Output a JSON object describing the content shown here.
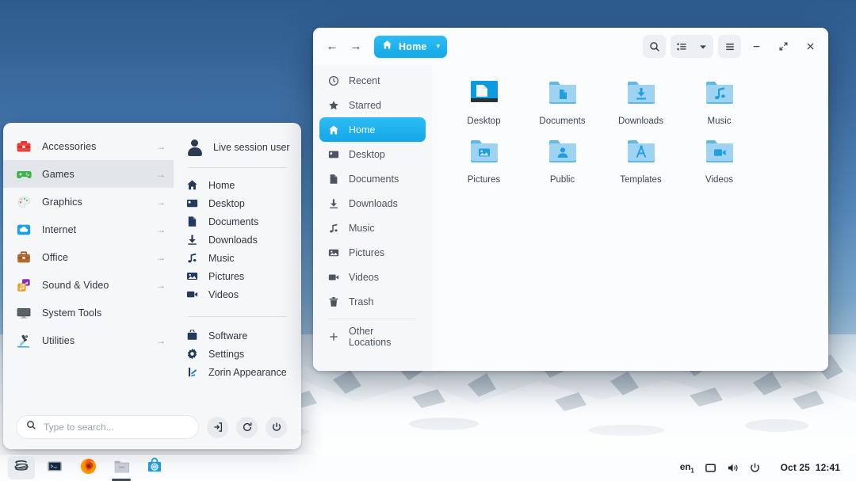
{
  "desktop": {
    "wallpaper_desc": "snowy-mountain-blue-sky"
  },
  "app_menu": {
    "categories": [
      {
        "label": "Accessories",
        "icon": "toolbox-red-icon",
        "arrow": "→",
        "active": false
      },
      {
        "label": "Games",
        "icon": "gamepad-green-icon",
        "arrow": "→",
        "active": true
      },
      {
        "label": "Graphics",
        "icon": "palette-icon",
        "arrow": "→",
        "active": false
      },
      {
        "label": "Internet",
        "icon": "cloud-blue-icon",
        "arrow": "→",
        "active": false
      },
      {
        "label": "Office",
        "icon": "briefcase-brown-icon",
        "arrow": "→",
        "active": false
      },
      {
        "label": "Sound & Video",
        "icon": "music-video-icon",
        "arrow": "→",
        "active": false
      },
      {
        "label": "System Tools",
        "icon": "monitor-icon",
        "arrow": "",
        "active": false
      },
      {
        "label": "Utilities",
        "icon": "microscope-icon",
        "arrow": "→",
        "active": false
      }
    ],
    "user": {
      "name": "Live session user",
      "icon": "user-avatar-icon"
    },
    "places": [
      {
        "label": "Home",
        "icon": "home-icon"
      },
      {
        "label": "Desktop",
        "icon": "desktop-icon"
      },
      {
        "label": "Documents",
        "icon": "document-icon"
      },
      {
        "label": "Downloads",
        "icon": "download-icon"
      },
      {
        "label": "Music",
        "icon": "music-note-icon"
      },
      {
        "label": "Pictures",
        "icon": "picture-icon"
      },
      {
        "label": "Videos",
        "icon": "video-camera-icon"
      }
    ],
    "system": [
      {
        "label": "Software",
        "icon": "software-bag-icon"
      },
      {
        "label": "Settings",
        "icon": "gear-icon"
      },
      {
        "label": "Zorin Appearance",
        "icon": "appearance-icon"
      }
    ],
    "search": {
      "placeholder": "Type to search...",
      "value": "",
      "icon": "search-icon"
    },
    "footer_buttons": [
      {
        "name": "logout-button",
        "icon": "logout-icon"
      },
      {
        "name": "restart-button",
        "icon": "restart-icon"
      },
      {
        "name": "power-button",
        "icon": "power-icon"
      }
    ]
  },
  "file_manager": {
    "title": "Home",
    "breadcrumb": {
      "label": "Home",
      "icon": "home-icon",
      "chevron": "▾"
    },
    "nav": {
      "back": "←",
      "forward": "→"
    },
    "toolbar": [
      {
        "name": "search-icon",
        "label": ""
      },
      {
        "name": "view-list-icon",
        "label": ""
      },
      {
        "name": "view-dropdown-icon",
        "label": ""
      },
      {
        "name": "hamburger-menu-icon",
        "label": ""
      }
    ],
    "window_controls": {
      "minimize": "–",
      "maximize": "⤡",
      "close": "✕"
    },
    "sidebar": [
      {
        "label": "Recent",
        "icon": "clock-icon",
        "active": false
      },
      {
        "label": "Starred",
        "icon": "star-icon",
        "active": false
      },
      {
        "label": "Home",
        "icon": "home-icon",
        "active": true
      },
      {
        "label": "Desktop",
        "icon": "desktop-icon",
        "active": false
      },
      {
        "label": "Documents",
        "icon": "document-icon",
        "active": false
      },
      {
        "label": "Downloads",
        "icon": "download-icon",
        "active": false
      },
      {
        "label": "Music",
        "icon": "music-note-icon",
        "active": false
      },
      {
        "label": "Pictures",
        "icon": "picture-icon",
        "active": false
      },
      {
        "label": "Videos",
        "icon": "video-camera-icon",
        "active": false
      },
      {
        "label": "Trash",
        "icon": "trash-icon",
        "active": false
      }
    ],
    "sidebar_other": {
      "label": "Other Locations",
      "icon": "plus-icon"
    },
    "files": [
      {
        "name": "Desktop",
        "icon": "desktop-folder-icon"
      },
      {
        "name": "Documents",
        "icon": "documents-folder-icon"
      },
      {
        "name": "Downloads",
        "icon": "downloads-folder-icon"
      },
      {
        "name": "Music",
        "icon": "music-folder-icon"
      },
      {
        "name": "Pictures",
        "icon": "pictures-folder-icon"
      },
      {
        "name": "Public",
        "icon": "public-folder-icon"
      },
      {
        "name": "Templates",
        "icon": "templates-folder-icon"
      },
      {
        "name": "Videos",
        "icon": "videos-folder-icon"
      }
    ]
  },
  "taskbar": {
    "apps": [
      {
        "name": "zorin-menu-button",
        "icon": "zorin-logo-icon",
        "state": "pressed"
      },
      {
        "name": "terminal-button",
        "icon": "terminal-icon",
        "state": "idle"
      },
      {
        "name": "firefox-button",
        "icon": "firefox-icon",
        "state": "idle"
      },
      {
        "name": "files-button",
        "icon": "files-folder-icon",
        "state": "running"
      },
      {
        "name": "software-button",
        "icon": "software-bag-icon",
        "state": "idle"
      }
    ],
    "tray": {
      "keyboard_layout": "en",
      "keyboard_sub": "1",
      "display_icon": "display-icon",
      "volume_icon": "volume-icon",
      "power_icon": "power-icon"
    },
    "clock": {
      "date": "Oct 25",
      "time": "12:41"
    }
  },
  "colors": {
    "accent": "#1fb0ef",
    "accent_dark": "#14a6e7",
    "menu_bg": "#f6f7f9",
    "window_bg": "#fbfcfd",
    "text": "#2f3640",
    "muted": "#4a5462"
  }
}
